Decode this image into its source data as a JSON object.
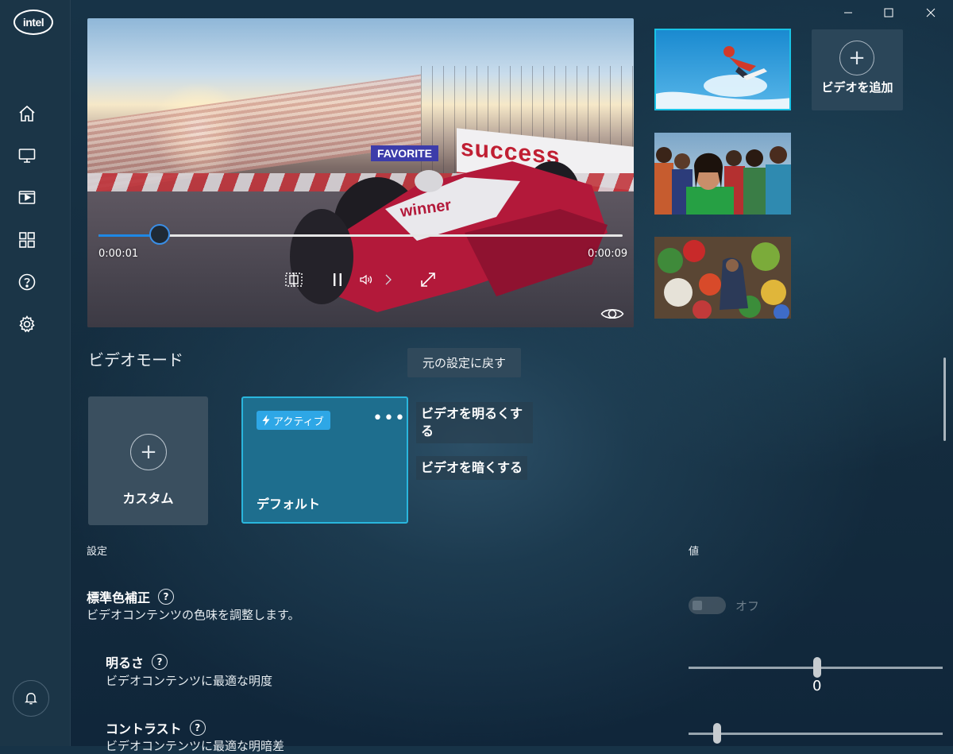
{
  "sidebar": {
    "logo": "intel",
    "items": [
      {
        "name": "home-icon"
      },
      {
        "name": "monitor-icon"
      },
      {
        "name": "video-icon"
      },
      {
        "name": "apps-grid-icon"
      },
      {
        "name": "help-icon"
      },
      {
        "name": "settings-icon"
      }
    ],
    "bell": "bell-icon"
  },
  "window": {
    "controls": [
      "minimize-icon",
      "maximize-icon",
      "close-icon"
    ]
  },
  "player": {
    "current_time": "0:00:01",
    "total_time": "0:00:09",
    "progress": 0.12,
    "banner_text": "success",
    "favorite_text": "FAVORITE",
    "car_text": "winner"
  },
  "thumbnails": [
    {
      "name": "snowboard-thumbnail",
      "selected": true
    },
    {
      "name": "crowd-thumbnail",
      "selected": false
    },
    {
      "name": "market-thumbnail",
      "selected": false
    }
  ],
  "add_video": {
    "label": "ビデオを追加"
  },
  "video_mode": {
    "title": "ビデオモード",
    "reset_label": "元の設定に戻す",
    "custom_label": "カスタム",
    "default_label": "デフォルト",
    "active_badge": "アクティブ",
    "more": "•••",
    "menu": {
      "brighten": "ビデオを明るくする",
      "darken": "ビデオを暗くする"
    }
  },
  "settings": {
    "col_setting": "設定",
    "col_value": "値",
    "color_correction": {
      "title": "標準色補正",
      "desc": "ビデオコンテンツの色味を調整します。",
      "toggle_label": "オフ",
      "enabled": false
    },
    "brightness": {
      "title": "明るさ",
      "desc": "ビデオコンテンツに最適な明度",
      "value": "0"
    },
    "contrast": {
      "title": "コントラスト",
      "desc": "ビデオコンテンツに最適な明暗差"
    }
  },
  "colors": {
    "accent": "#2ab6dd",
    "active_badge": "#2ea7e6",
    "seek": "#1e88e5",
    "background": "#173347"
  }
}
